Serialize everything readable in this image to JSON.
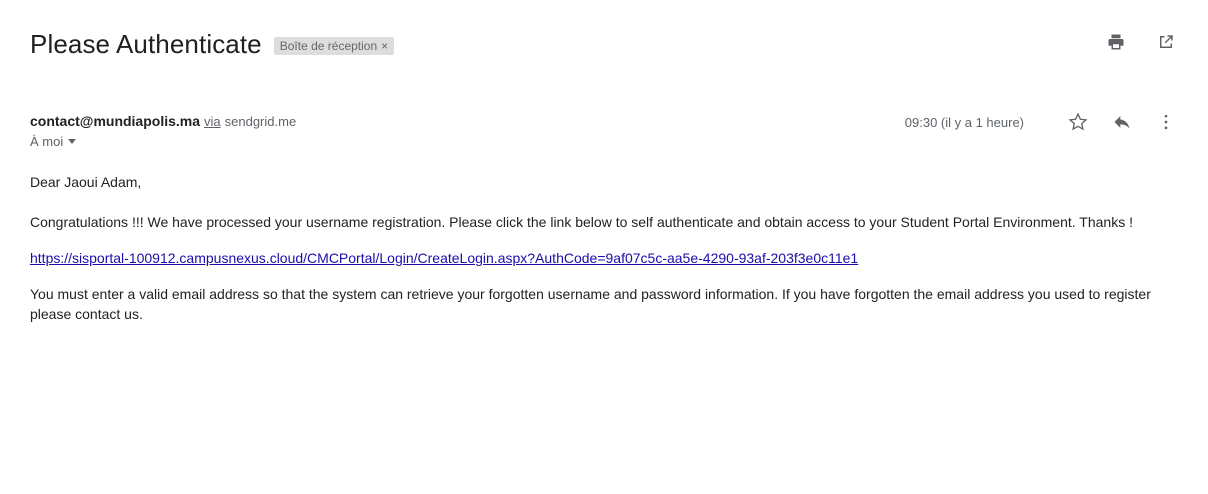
{
  "email": {
    "subject": "Please Authenticate",
    "label": "Boîte de réception",
    "label_close": "×",
    "sender_email": "contact@mundiapolis.ma",
    "via_text": "via",
    "via_domain": "sendgrid.me",
    "timestamp": "09:30 (il y a 1 heure)",
    "recipient": "À moi",
    "body": {
      "greeting": "Dear Jaoui Adam,",
      "paragraph1": "Congratulations !!! We have processed your username registration. Please click the link below to self authenticate and obtain access to your Student Portal Environment. Thanks !",
      "link": "https://sisportal-100912.campusnexus.cloud/CMCPortal/Login/CreateLogin.aspx?AuthCode=9af07c5c-aa5e-4290-93af-203f3e0c11e1",
      "paragraph2": "You must enter a valid email address so that the system can retrieve your forgotten username and password information. If you have forgotten the email address you used to register please contact us."
    }
  },
  "icons": {
    "print": "printer-icon",
    "new_window": "open-in-new-window-icon",
    "star": "star-icon",
    "reply": "reply-icon",
    "more": "more-vertical-icon",
    "dropdown": "caret-down-icon"
  },
  "colors": {
    "link": "#1a0dab",
    "chip_bg": "#dddddd",
    "muted": "#5f6368"
  }
}
